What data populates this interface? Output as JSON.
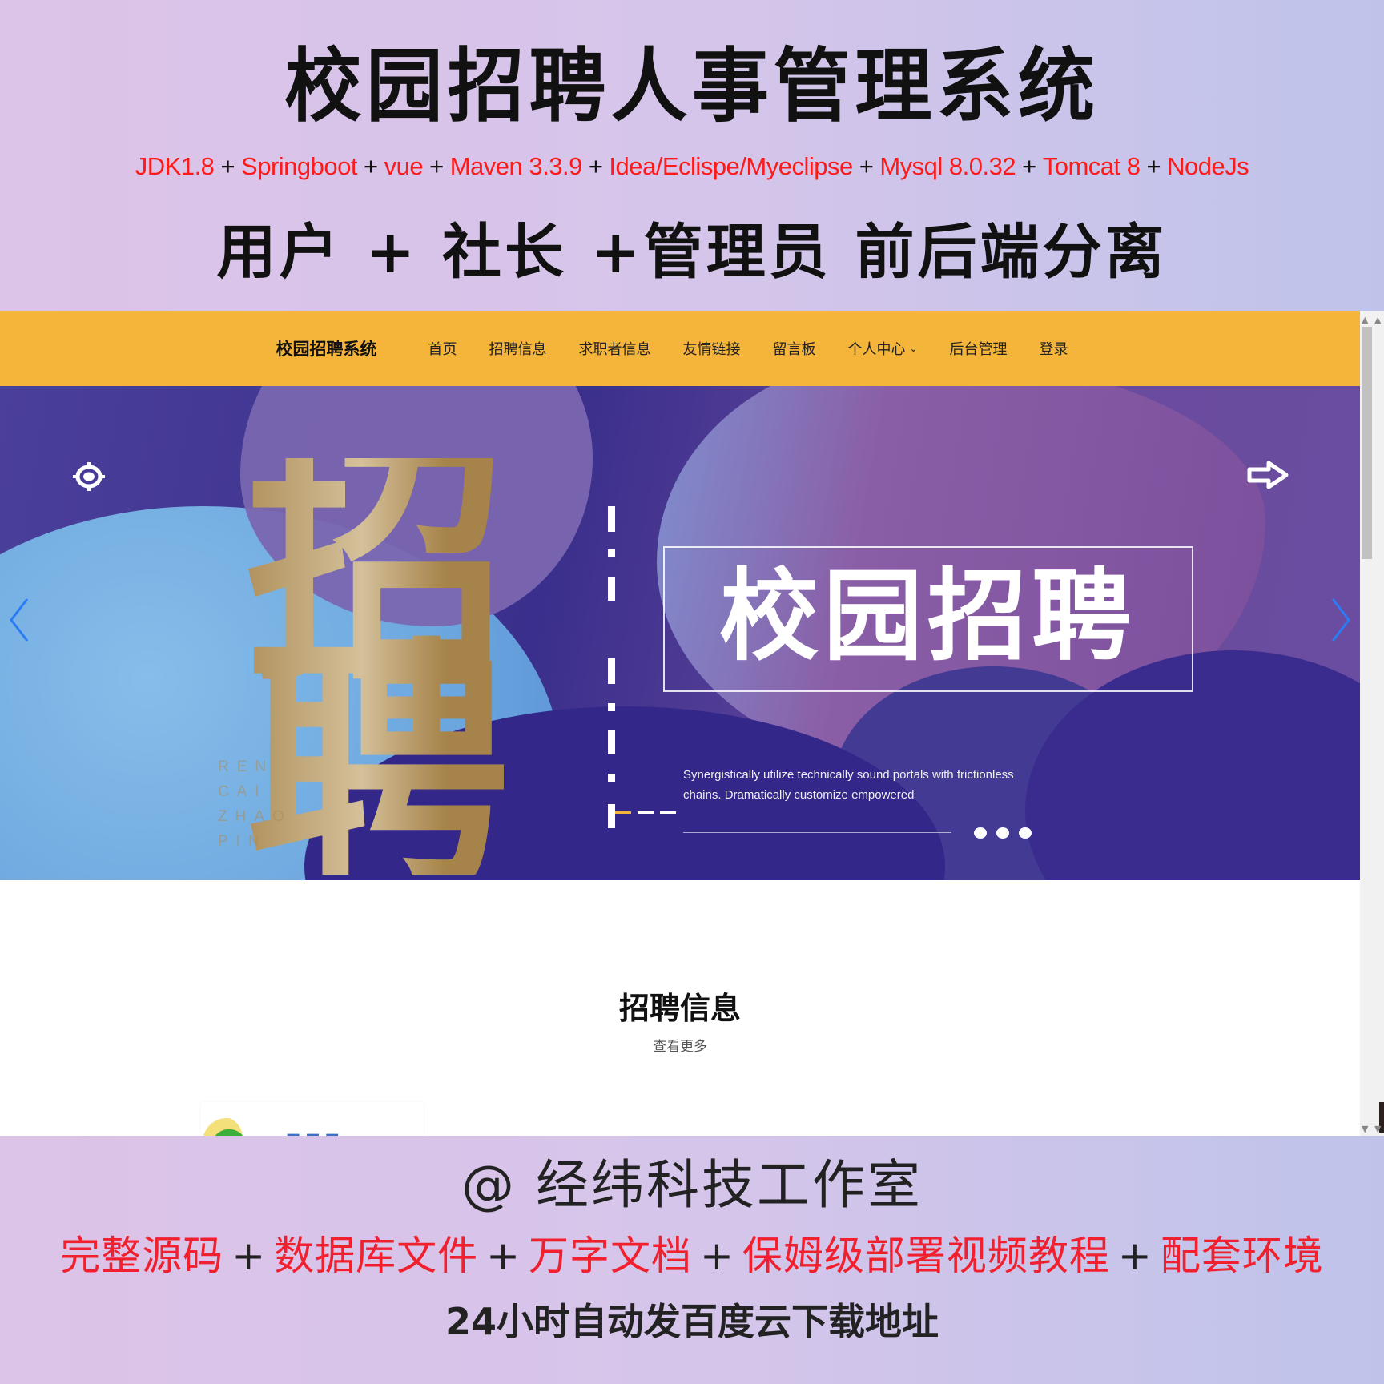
{
  "promo_top": {
    "title": "校园招聘人事管理系统",
    "tech_stack": [
      "JDK1.8",
      "Springboot",
      "vue",
      "Maven 3.3.9",
      "Idea/Eclispe/Myeclipse",
      "Mysql 8.0.32",
      "Tomcat 8",
      "NodeJs"
    ],
    "separator": "+",
    "roles_line": "用户 + 社长 +管理员 前后端分离"
  },
  "navbar": {
    "brand": "校园招聘系统",
    "items": [
      {
        "label": "首页"
      },
      {
        "label": "招聘信息"
      },
      {
        "label": "求职者信息"
      },
      {
        "label": "友情链接"
      },
      {
        "label": "留言板"
      },
      {
        "label": "个人中心",
        "has_dropdown": true
      },
      {
        "label": "后台管理"
      },
      {
        "label": "登录"
      }
    ],
    "background_color": "#f5b43a"
  },
  "hero": {
    "big_char": "招聘",
    "pinyin": [
      "REN",
      "CAI",
      "ZHAO",
      "PIN"
    ],
    "headline": "校园招聘",
    "description": "Synergistically utilize technically sound portals with frictionless chains. Dramatically customize empowered",
    "left_icon": "target-icon",
    "right_icon": "arrow-right-icon",
    "prev_label": "‹",
    "next_label": "›",
    "arrow_color": "#2a7cf6"
  },
  "section": {
    "title": "招聘信息",
    "more_link": "查看更多"
  },
  "promo_bottom": {
    "studio": "@ 经纬科技工作室",
    "features": [
      "完整源码",
      "数据库文件",
      "万字文档",
      "保姆级部署视频教程",
      "配套环境"
    ],
    "separator": "+",
    "download_note": "24小时自动发百度云下载地址"
  },
  "colors": {
    "accent_red": "#ff1a1a",
    "nav_orange": "#f5b43a",
    "gold": "#a9874c"
  }
}
